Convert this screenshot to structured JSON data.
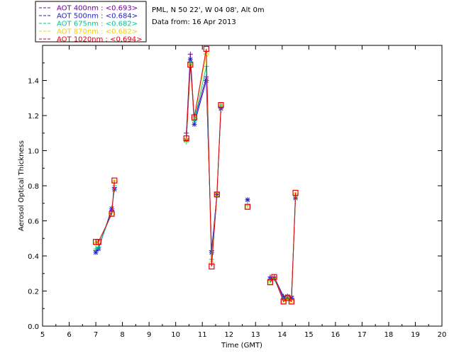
{
  "chart_data": {
    "type": "line",
    "title": "",
    "info_lines": [
      "PML, N 50 22', W 04 08', Alt 0m",
      "Data from: 16 Apr 2013"
    ],
    "xlabel": "Time (GMT)",
    "ylabel": "Aerosol Optical Thickness",
    "xlim": [
      5,
      20
    ],
    "ylim": [
      0.0,
      1.6
    ],
    "xticks": [
      "5",
      "6",
      "7",
      "8",
      "9",
      "10",
      "11",
      "12",
      "13",
      "14",
      "15",
      "16",
      "17",
      "18",
      "19",
      "20"
    ],
    "yticks": [
      "0.0",
      "0.2",
      "0.4",
      "0.6",
      "0.8",
      "1.0",
      "1.2",
      "1.4"
    ],
    "grid": false,
    "legend_position": "top-left",
    "series": [
      {
        "name": "AOT  400nm : <0.693>",
        "color": "#7000a0",
        "marker": "plus",
        "x": [
          7.0,
          7.1,
          7.6,
          7.7,
          10.4,
          10.55,
          10.7,
          11.15,
          11.35,
          11.55,
          11.7,
          12.7,
          13.55,
          13.7,
          14.05,
          14.2,
          14.35,
          14.5
        ],
        "y": [
          0.43,
          0.45,
          0.66,
          0.79,
          1.1,
          1.55,
          1.17,
          1.42,
          0.43,
          0.75,
          1.25,
          0.72,
          0.28,
          0.28,
          0.17,
          0.17,
          0.17,
          0.74
        ]
      },
      {
        "name": "AOT  500nm : <0.684>",
        "color": "#2020d0",
        "marker": "star",
        "x": [
          7.0,
          7.1,
          7.6,
          7.7,
          10.4,
          10.55,
          10.7,
          11.15,
          11.35,
          11.55,
          11.7,
          12.7,
          13.55,
          13.7,
          14.05,
          14.2,
          14.35,
          14.5
        ],
        "y": [
          0.42,
          0.44,
          0.67,
          0.78,
          1.06,
          1.52,
          1.15,
          1.4,
          0.42,
          0.75,
          1.24,
          0.72,
          0.27,
          0.27,
          0.16,
          0.17,
          0.16,
          0.73
        ]
      },
      {
        "name": "AOT  675nm : <0.682>",
        "color": "#00c890",
        "marker": "plus",
        "x": [
          7.0,
          7.1,
          7.6,
          7.7,
          10.4,
          10.55,
          10.7,
          11.15,
          11.35,
          11.55,
          11.7,
          12.7,
          13.55,
          13.7,
          14.05,
          14.2,
          14.35,
          14.5
        ],
        "y": [
          0.44,
          0.45,
          0.65,
          0.8,
          1.05,
          1.5,
          1.17,
          1.48,
          0.38,
          0.74,
          1.26,
          0.69,
          0.26,
          0.27,
          0.15,
          0.16,
          0.15,
          0.74
        ]
      },
      {
        "name": "AOT  870nm : <0.682>",
        "color": "#f0d000",
        "marker": "diamond",
        "x": [
          7.0,
          7.1,
          7.6,
          7.7,
          10.4,
          10.55,
          10.7,
          11.15,
          11.35,
          11.55,
          11.7,
          12.7,
          13.55,
          13.7,
          14.05,
          14.2,
          14.35,
          14.5
        ],
        "y": [
          0.47,
          0.48,
          0.64,
          0.82,
          1.06,
          1.49,
          1.19,
          1.55,
          0.36,
          0.75,
          1.26,
          0.68,
          0.25,
          0.28,
          0.14,
          0.16,
          0.14,
          0.75
        ]
      },
      {
        "name": "AOT 1020nm : <0.694>",
        "color": "#e00010",
        "marker": "square",
        "x": [
          7.0,
          7.1,
          7.6,
          7.7,
          10.4,
          10.55,
          10.7,
          11.15,
          11.35,
          11.55,
          11.7,
          12.7,
          13.55,
          13.7,
          14.05,
          14.2,
          14.35,
          14.5
        ],
        "y": [
          0.48,
          0.48,
          0.64,
          0.83,
          1.07,
          1.49,
          1.19,
          1.58,
          0.34,
          0.75,
          1.26,
          0.68,
          0.25,
          0.28,
          0.14,
          0.16,
          0.14,
          0.76
        ]
      }
    ]
  }
}
